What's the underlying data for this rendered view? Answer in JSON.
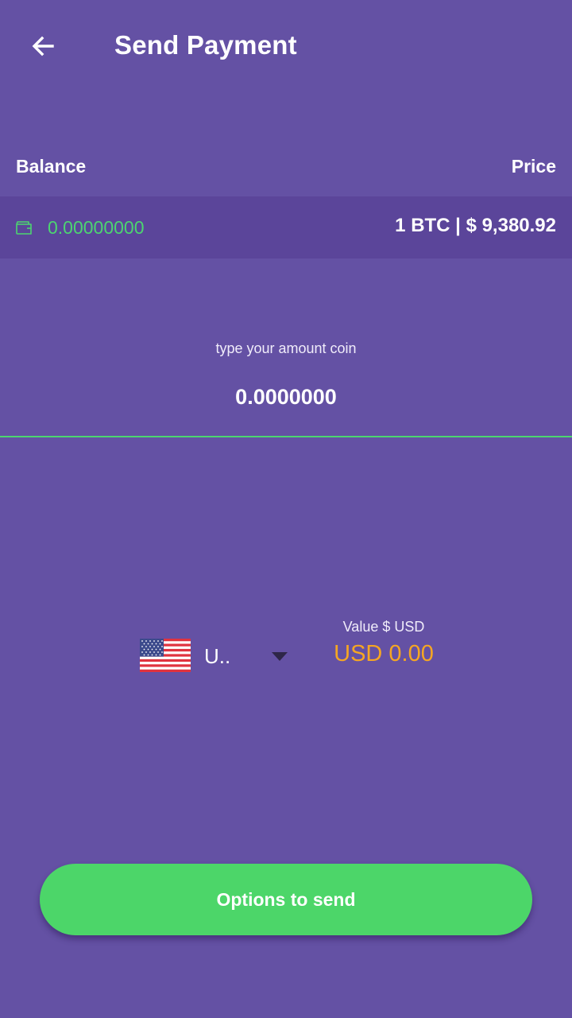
{
  "header": {
    "title": "Send Payment",
    "back_icon": "arrow-left-icon"
  },
  "summary": {
    "balance_label": "Balance",
    "price_label": "Price",
    "balance_value": "0.00000000",
    "price_value": "1 BTC | $ 9,380.92",
    "wallet_icon": "wallet-icon"
  },
  "amount": {
    "hint": "type your amount coin",
    "value": "0.0000000"
  },
  "currency": {
    "flag": "us-flag-icon",
    "code": "U..",
    "value_label": "Value $ USD",
    "value": "USD 0.00"
  },
  "actions": {
    "send_label": "Options to send"
  },
  "colors": {
    "background": "#6451a4",
    "balance_row": "#5b459a",
    "accent_green": "#4cd570",
    "value_orange": "#f5a623",
    "button_green": "#4cd669"
  }
}
